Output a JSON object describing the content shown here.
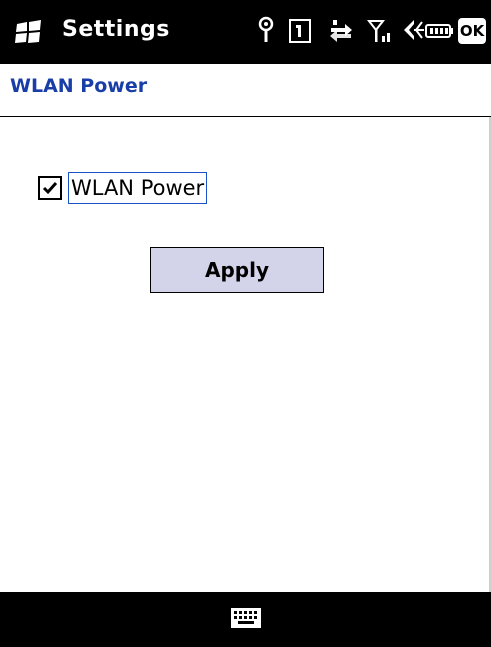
{
  "status_bar": {
    "app_title": "Settings",
    "ok_label": "OK",
    "icons": [
      "start-icon",
      "connectivity-icon",
      "sim-slot-icon",
      "data-sync-icon",
      "signal-strength-icon",
      "speaker-icon",
      "battery-icon"
    ]
  },
  "page": {
    "title": "WLAN Power"
  },
  "form": {
    "checkbox_label": "WLAN Power",
    "checkbox_checked": true,
    "apply_label": "Apply"
  },
  "bottom_bar": {
    "icons": [
      "keyboard-icon"
    ]
  },
  "colors": {
    "title_blue": "#1a3ea8",
    "button_fill": "#d3d3ea",
    "bar_black": "#000000"
  }
}
